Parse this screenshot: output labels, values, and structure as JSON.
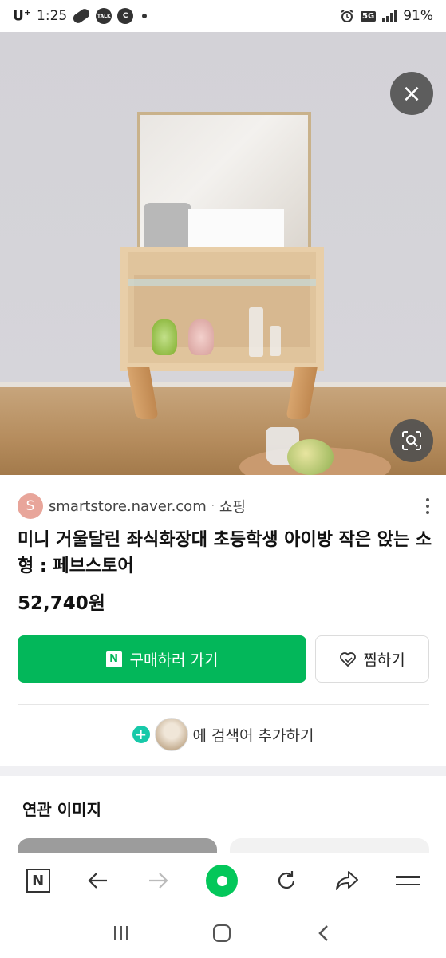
{
  "status_bar": {
    "carrier": "U",
    "carrier_sup": "+",
    "time": "1:25",
    "talk_label": "TALK",
    "c_label": "C",
    "network": "5G",
    "battery": "91%"
  },
  "hero": {
    "close_icon": "×"
  },
  "result": {
    "source_initial": "S",
    "source_domain": "smartstore.naver.com",
    "source_separator": "·",
    "source_category": "쇼핑",
    "title": "미니 거울달린 좌식화장대 초등학생 아이방 작은 앉는 소형 : 페브스토어",
    "price": "52,740원",
    "buy_button_badge": "N",
    "buy_button_label": "구매하러 가기",
    "wish_button_label": "찜하기",
    "add_search_label": "에 검색어 추가하기",
    "add_search_plus": "+"
  },
  "related": {
    "title": "연관 이미지"
  },
  "toolbar": {
    "n_label": "N",
    "back_icon": "←",
    "forward_icon": "→",
    "refresh_icon": "↻",
    "share_icon": "➦"
  },
  "sysnav": {
    "back_icon": "‹"
  },
  "colors": {
    "accent_green": "#03b75a",
    "plus_teal": "#17c9a9"
  }
}
